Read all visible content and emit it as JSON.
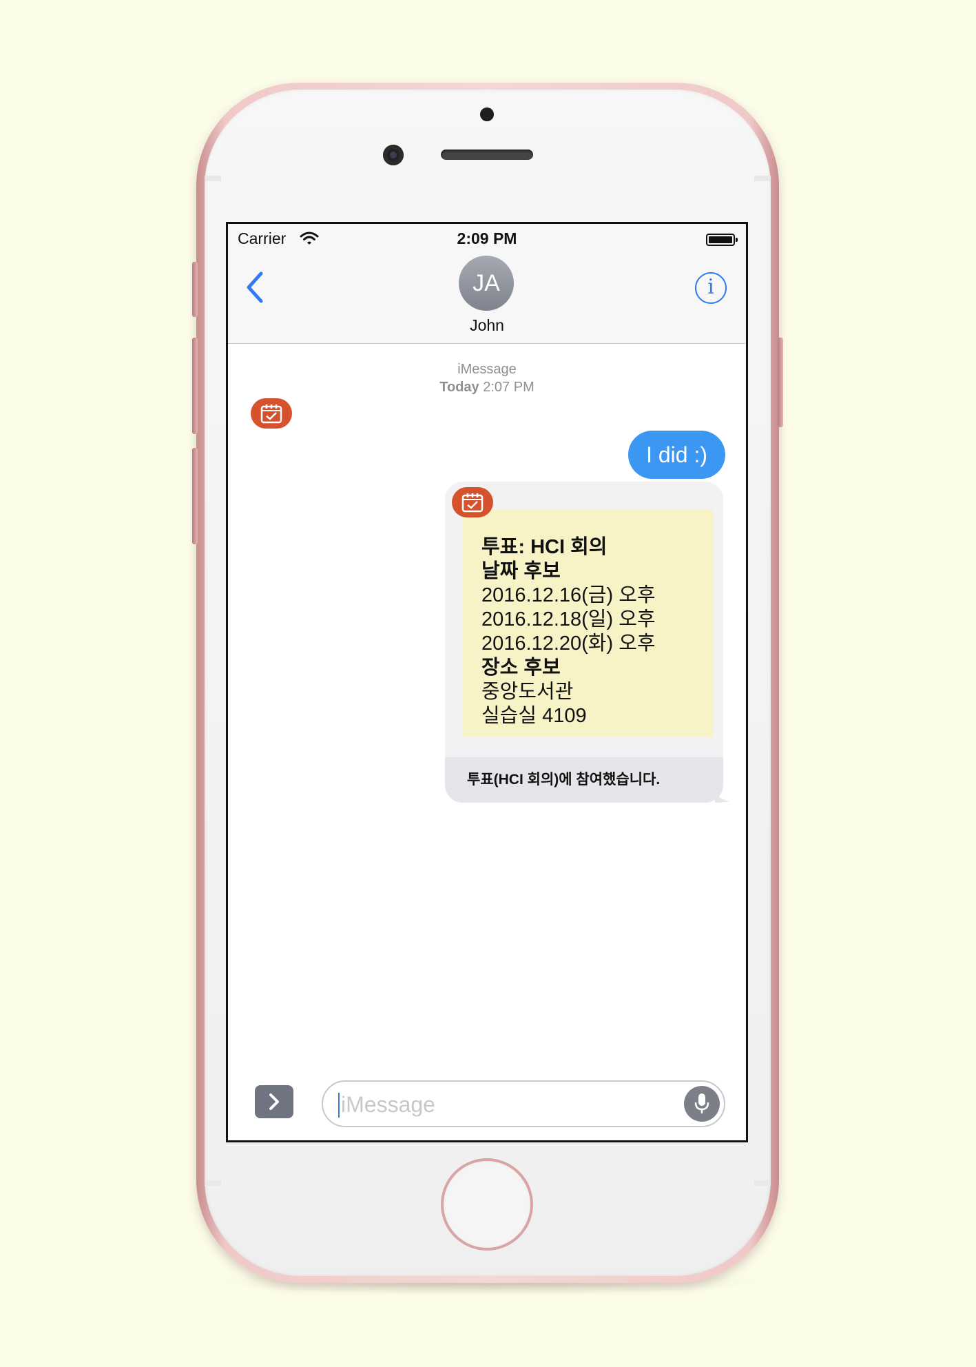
{
  "status_bar": {
    "carrier": "Carrier",
    "time": "2:09 PM"
  },
  "header": {
    "avatar_initials": "JA",
    "contact_name": "John"
  },
  "thread": {
    "service": "iMessage",
    "day": "Today",
    "time": "2:07 PM"
  },
  "messages": {
    "outgoing_text": "I did :)",
    "poll": {
      "lines": [
        {
          "text": "투표: HCI 회의",
          "bold": true
        },
        {
          "text": "날짜 후보",
          "bold": true
        },
        {
          "text": "2016.12.16(금) 오후",
          "bold": false
        },
        {
          "text": "2016.12.18(일) 오후",
          "bold": false
        },
        {
          "text": "2016.12.20(화) 오후",
          "bold": false
        },
        {
          "text": "장소 후보",
          "bold": true
        },
        {
          "text": "중앙도서관",
          "bold": false
        },
        {
          "text": "실습실 4109",
          "bold": false
        }
      ],
      "caption": "투표(HCI 회의)에 참여했습니다."
    }
  },
  "input": {
    "placeholder": "iMessage"
  },
  "icons": {
    "back": "chevron-left-icon",
    "info": "info-icon",
    "wifi": "wifi-icon",
    "battery": "battery-icon",
    "app_badge": "calendar-check-icon",
    "expand": "chevron-right-icon",
    "mic": "microphone-icon"
  },
  "colors": {
    "background": "#fbfde9",
    "accent_blue": "#2f7bf2",
    "bubble_blue": "#3c97f2",
    "app_badge": "#d5522d",
    "poll_card": "#f7f3c7"
  }
}
